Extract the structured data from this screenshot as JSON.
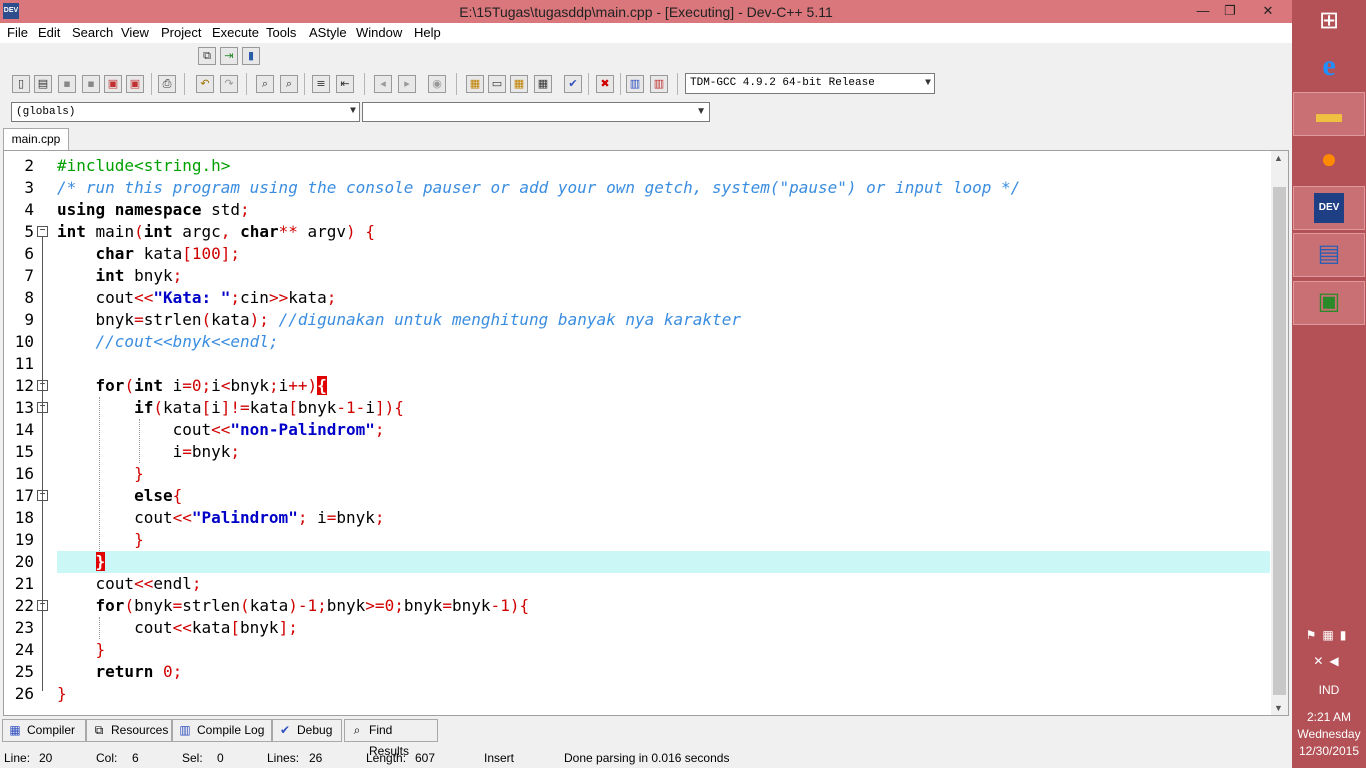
{
  "window": {
    "title": "E:\\15Tugas\\tugasddp\\main.cpp - [Executing] - Dev-C++ 5.11",
    "app_icon_label": "DEV",
    "minimize": "—",
    "restore": "❐",
    "close": "✕"
  },
  "menu": [
    "File",
    "Edit",
    "Search",
    "View",
    "Project",
    "Execute",
    "Tools",
    "AStyle",
    "Window",
    "Help"
  ],
  "toolbar": {
    "compiler": "TDM-GCC 4.9.2 64-bit Release",
    "scope": "(globals)",
    "function": ""
  },
  "editor": {
    "tab": "main.cpp",
    "line_numbers": [
      "2",
      "3",
      "4",
      "5",
      "6",
      "7",
      "8",
      "9",
      "10",
      "11",
      "12",
      "13",
      "14",
      "15",
      "16",
      "17",
      "18",
      "19",
      "20",
      "21",
      "22",
      "23",
      "24",
      "25",
      "26"
    ]
  },
  "bottom_tabs": [
    "Compiler",
    "Resources",
    "Compile Log",
    "Debug",
    "Find Results"
  ],
  "status": {
    "line_label": "Line:",
    "line_value": "20",
    "col_label": "Col:",
    "col_value": "6",
    "sel_label": "Sel:",
    "sel_value": "0",
    "lines_label": "Lines:",
    "lines_value": "26",
    "length_label": "Length:",
    "length_value": "607",
    "mode": "Insert",
    "message": "Done parsing in 0.016 seconds"
  },
  "taskbar": {
    "dev_label": "DEV",
    "lang": "IND",
    "time": "2:21 AM",
    "day": "Wednesday",
    "date": "12/30/2015"
  },
  "colors": {
    "titlebar": "#d9777c",
    "taskbar": "#b35156",
    "current_line": "#ccf7f7",
    "comment": "#3a8de0",
    "symbol": "#d00000",
    "string": "#0000c8"
  }
}
